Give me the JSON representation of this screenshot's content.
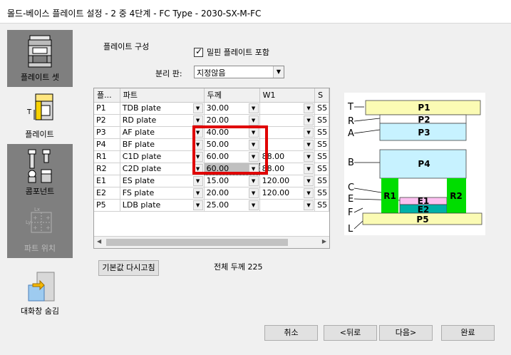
{
  "window": {
    "title": "몰드-베이스 플레이트 설정 - 2 중 4단계  - FC Type - 2030-SX-M-FC"
  },
  "sidebar": {
    "items": [
      {
        "label": "플레이트 셋",
        "icon": "plate-set-icon",
        "state": "normal"
      },
      {
        "label": "플레이트",
        "icon": "plate-icon",
        "state": "active"
      },
      {
        "label": "콤포넌트",
        "icon": "component-icon",
        "state": "normal"
      },
      {
        "label": "파트 위치",
        "icon": "part-position-icon",
        "state": "disabled"
      }
    ],
    "collapse": {
      "label": "대화창 숨김",
      "icon": "hide-dialog-icon"
    }
  },
  "plate_config": {
    "section_title": "플레이트 구성",
    "include_pin_plate_label": "밀핀 플레이트 포함",
    "include_pin_plate_checked": true,
    "separation_label": "분리 판:",
    "separation_value": "지정않음"
  },
  "grid": {
    "columns": [
      "플...",
      "파트",
      "두께",
      "W1",
      "S"
    ],
    "rows": [
      {
        "id": "P1",
        "part": "TDB plate",
        "thickness": "30.00",
        "w1": "",
        "s": "S5"
      },
      {
        "id": "P2",
        "part": "RD plate",
        "thickness": "20.00",
        "w1": "",
        "s": "S5"
      },
      {
        "id": "P3",
        "part": "AF plate",
        "thickness": "40.00",
        "w1": "",
        "s": "S5"
      },
      {
        "id": "P4",
        "part": "BF plate",
        "thickness": "50.00",
        "w1": "",
        "s": "S5"
      },
      {
        "id": "R1",
        "part": "C1D plate",
        "thickness": "60.00",
        "w1": "88.00",
        "s": "S5"
      },
      {
        "id": "R2",
        "part": "C2D plate",
        "thickness": "60.00",
        "w1": "88.00",
        "s": "S5"
      },
      {
        "id": "E1",
        "part": "ES plate",
        "thickness": "15.00",
        "w1": "120.00",
        "s": "S5"
      },
      {
        "id": "E2",
        "part": "FS plate",
        "thickness": "20.00",
        "w1": "120.00",
        "s": "S5"
      },
      {
        "id": "P5",
        "part": "LDB plate",
        "thickness": "25.00",
        "w1": "",
        "s": "S5"
      }
    ]
  },
  "reset_button": "기본값 다시고침",
  "total_thickness": "전체 두께 225",
  "diagram": {
    "side_labels": [
      "T",
      "R",
      "A",
      "B",
      "C",
      "E",
      "F",
      "L"
    ],
    "plates": [
      "P1",
      "P2",
      "P3",
      "P4",
      "R1",
      "E1",
      "E2",
      "R2",
      "P5"
    ],
    "colors": {
      "yellow": "#fbfbb4",
      "cyan": "#c7f2ff",
      "green": "#00dd00",
      "pink": "#fcc0f0",
      "teal": "#00b0a8"
    }
  },
  "footer": {
    "cancel": "취소",
    "back": "<뒤로",
    "next": "다음>",
    "finish": "완료"
  }
}
